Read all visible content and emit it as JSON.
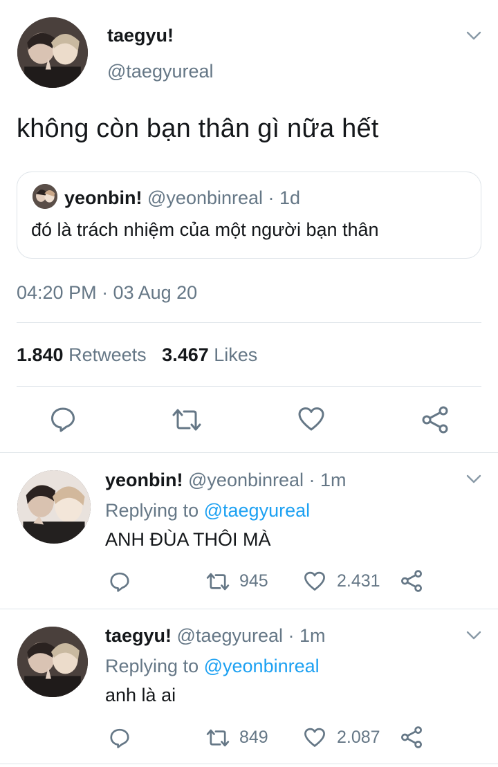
{
  "main_tweet": {
    "display_name": "taegyu!",
    "handle": "@taegyureal",
    "text": "không còn bạn thân gì nữa hết",
    "quoted": {
      "display_name": "yeonbin!",
      "handle_time": "@yeonbinreal · 1d",
      "text": "đó là trách nhiệm của một người bạn thân"
    },
    "timestamp": "04:20 PM · 03 Aug 20",
    "stats": {
      "retweets_count": "1.840",
      "retweets_label": "Retweets",
      "likes_count": "3.467",
      "likes_label": "Likes"
    }
  },
  "replies": [
    {
      "display_name": "yeonbin!",
      "handle_time": "@yeonbinreal · 1m",
      "replying_prefix": "Replying to",
      "replying_handle": "@taegyureal",
      "text": "ANH ĐÙA THÔI MÀ",
      "retweets": "945",
      "likes": "2.431"
    },
    {
      "display_name": "taegyu!",
      "handle_time": "@taegyureal · 1m",
      "replying_prefix": "Replying to",
      "replying_handle": "@yeonbinreal",
      "text": "anh là ai",
      "retweets": "849",
      "likes": "2.087"
    }
  ],
  "icons": {
    "reply": "reply-icon",
    "retweet": "retweet-icon",
    "like": "heart-icon",
    "share": "share-icon",
    "more": "chevron-down-icon"
  },
  "colors": {
    "text": "#14171a",
    "secondary": "#657786",
    "link": "#1da1f2",
    "divider": "#dde3e8"
  }
}
